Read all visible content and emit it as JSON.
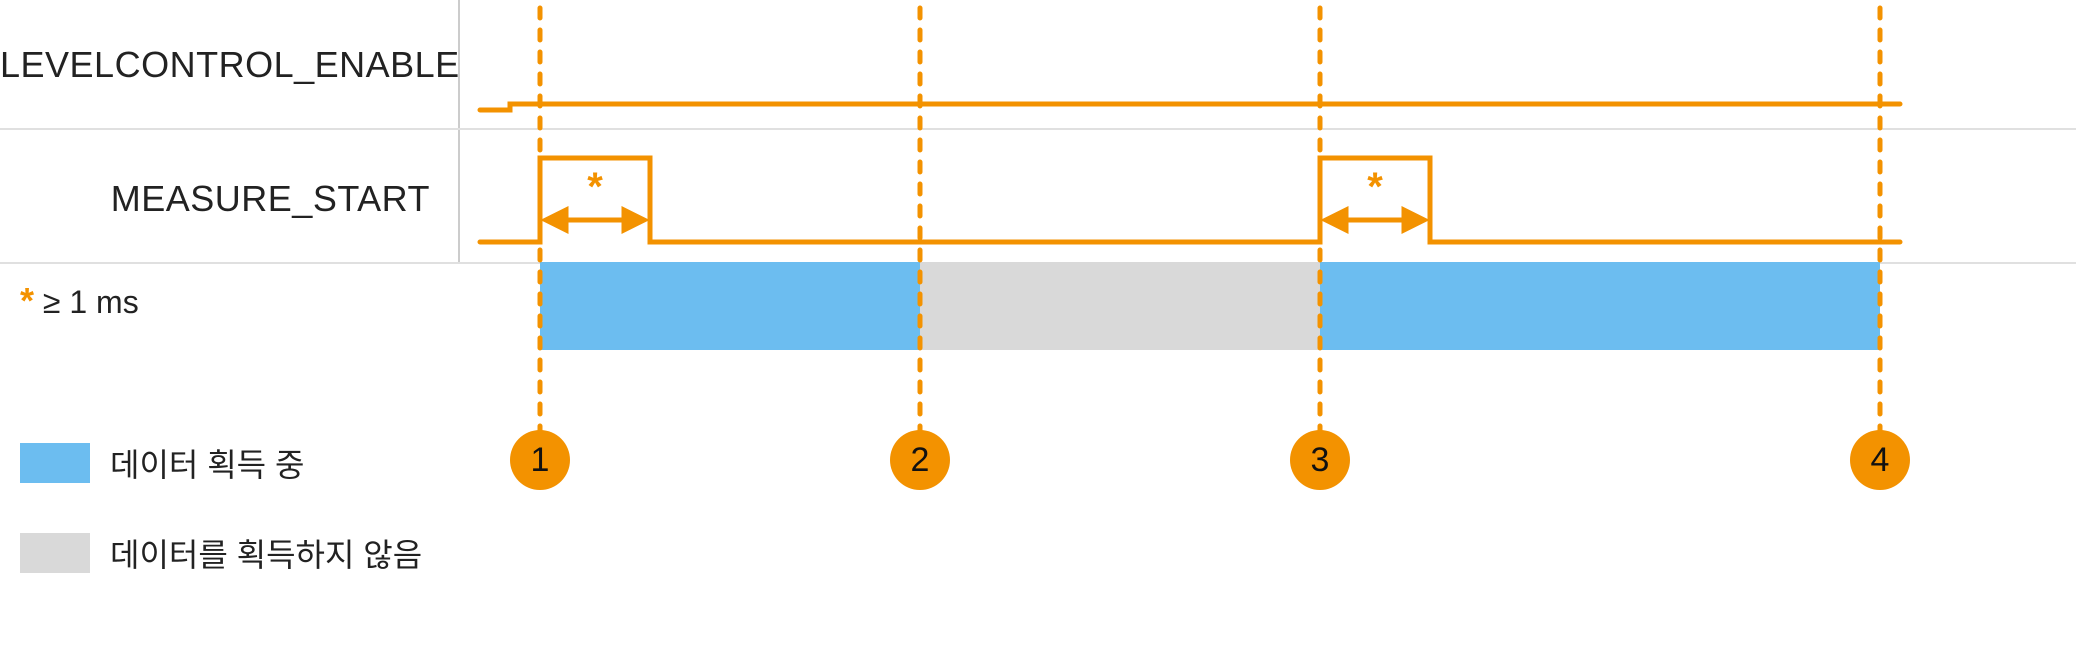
{
  "signals": {
    "level_enable_label": "LEVELCONTROL_ENABLE",
    "measure_start_label": "MEASURE_START"
  },
  "pulse_annotation": {
    "symbol": "*",
    "note_text": "≥ 1 ms"
  },
  "legend": {
    "acquiring_label": "데이터 획득 중",
    "not_acquiring_label": "데이터를 획득하지 않음"
  },
  "markers": {
    "m1": "1",
    "m2": "2",
    "m3": "3",
    "m4": "4"
  },
  "colors": {
    "signal": "#f39200",
    "blue_band": "#6cbdf0",
    "gray_band": "#d9d9d9",
    "guide_dash": "#f39200"
  },
  "chart_data": {
    "type": "timing-diagram",
    "title": "",
    "x_unit": "ms",
    "signals": [
      {
        "name": "LEVELCONTROL_ENABLE",
        "transitions": [
          {
            "t": 0.0,
            "level": 0
          },
          {
            "t": 0.5,
            "level": 1
          }
        ]
      },
      {
        "name": "MEASURE_START",
        "transitions": [
          {
            "t": 0.0,
            "level": 0
          },
          {
            "t": 1.0,
            "level": 1
          },
          {
            "t": 2.0,
            "level": 0
          },
          {
            "t": 10.0,
            "level": 1
          },
          {
            "t": 11.0,
            "level": 0
          }
        ],
        "pulse_min_width_ms": 1
      }
    ],
    "acquisition_bands": [
      {
        "from_marker": 1,
        "to_marker": 2,
        "state": "acquiring"
      },
      {
        "from_marker": 2,
        "to_marker": 3,
        "state": "idle"
      },
      {
        "from_marker": 3,
        "to_marker": 4,
        "state": "acquiring"
      }
    ],
    "markers": [
      {
        "id": 1,
        "label": "1",
        "t": 1.0
      },
      {
        "id": 2,
        "label": "2",
        "t": 6.0
      },
      {
        "id": 3,
        "label": "3",
        "t": 10.0
      },
      {
        "id": 4,
        "label": "4",
        "t": 15.0
      }
    ]
  }
}
